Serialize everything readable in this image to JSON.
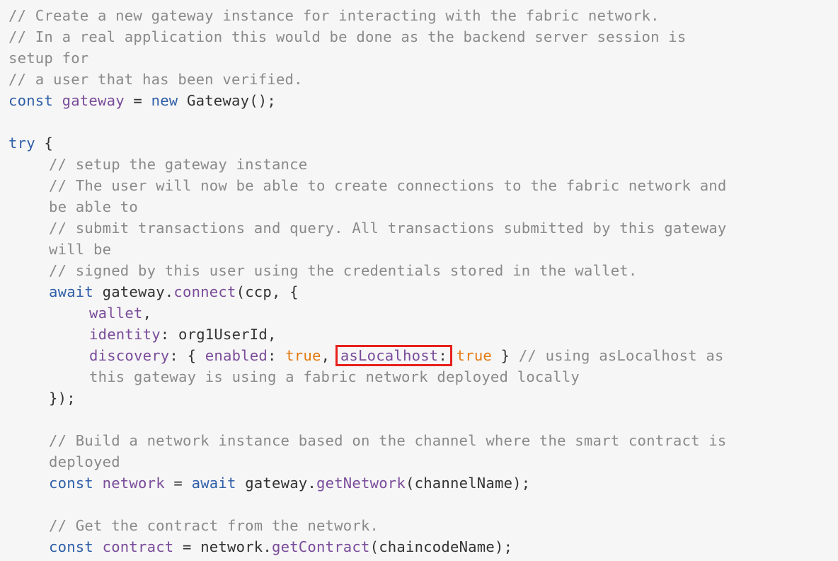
{
  "colors": {
    "background": "#f6f6f6",
    "comment": "#8a8a8a",
    "keyword": "#2f5fa8",
    "property": "#7a4c9a",
    "boolean": "#e57a12",
    "text": "#333333",
    "highlight_box": "#e8201c"
  },
  "code": {
    "c1": "// Create a new gateway instance for interacting with the fabric network.",
    "c2": "// In a real application this would be done as the backend server session is",
    "c3": "setup for",
    "c4": "// a user that has been verified.",
    "l5_kw": "const",
    "l5_var": "gateway",
    "l5_eq": " = ",
    "l5_new": "new",
    "l5_rest": " Gateway();",
    "l7_kw": "try",
    "l7_rest": " {",
    "c8": "// setup the gateway instance",
    "c9": "// The user will now be able to create connections to the fabric network and",
    "c10": "be able to",
    "c11": "// submit transactions and query. All transactions submitted by this gateway",
    "c12": "will be",
    "c13": "// signed by this user using the credentials stored in the wallet.",
    "l14_kw": "await",
    "l14_obj": " gateway.",
    "l14_fn": "connect",
    "l14_rest": "(ccp, {",
    "l15_prop": "wallet",
    "l15_rest": ",",
    "l16_prop": "identity",
    "l16_rest": ": org1UserId,",
    "l17_prop": "discovery",
    "l17_a": ": { ",
    "l17_enabled": "enabled",
    "l17_b": ": ",
    "l17_true1": "true",
    "l17_c": ", ",
    "l17_aslocal": "asLocalhost",
    "l17_colon": ":",
    "l17_d": " ",
    "l17_true2": "true",
    "l17_e": " } ",
    "l17_comment": "// using asLocalhost as",
    "l18_comment": "this gateway is using a fabric network deployed locally",
    "l19": "});",
    "c21": "// Build a network instance based on the channel where the smart contract is",
    "c22": "deployed",
    "l23_kw": "const",
    "l23_var": "network",
    "l23_eq": " = ",
    "l23_await": "await",
    "l23_obj": " gateway.",
    "l23_fn": "getNetwork",
    "l23_rest": "(channelName);",
    "c25": "// Get the contract from the network.",
    "l26_kw": "const",
    "l26_var": "contract",
    "l26_eq": " = network.",
    "l26_fn": "getContract",
    "l26_rest": "(chaincodeName);"
  }
}
